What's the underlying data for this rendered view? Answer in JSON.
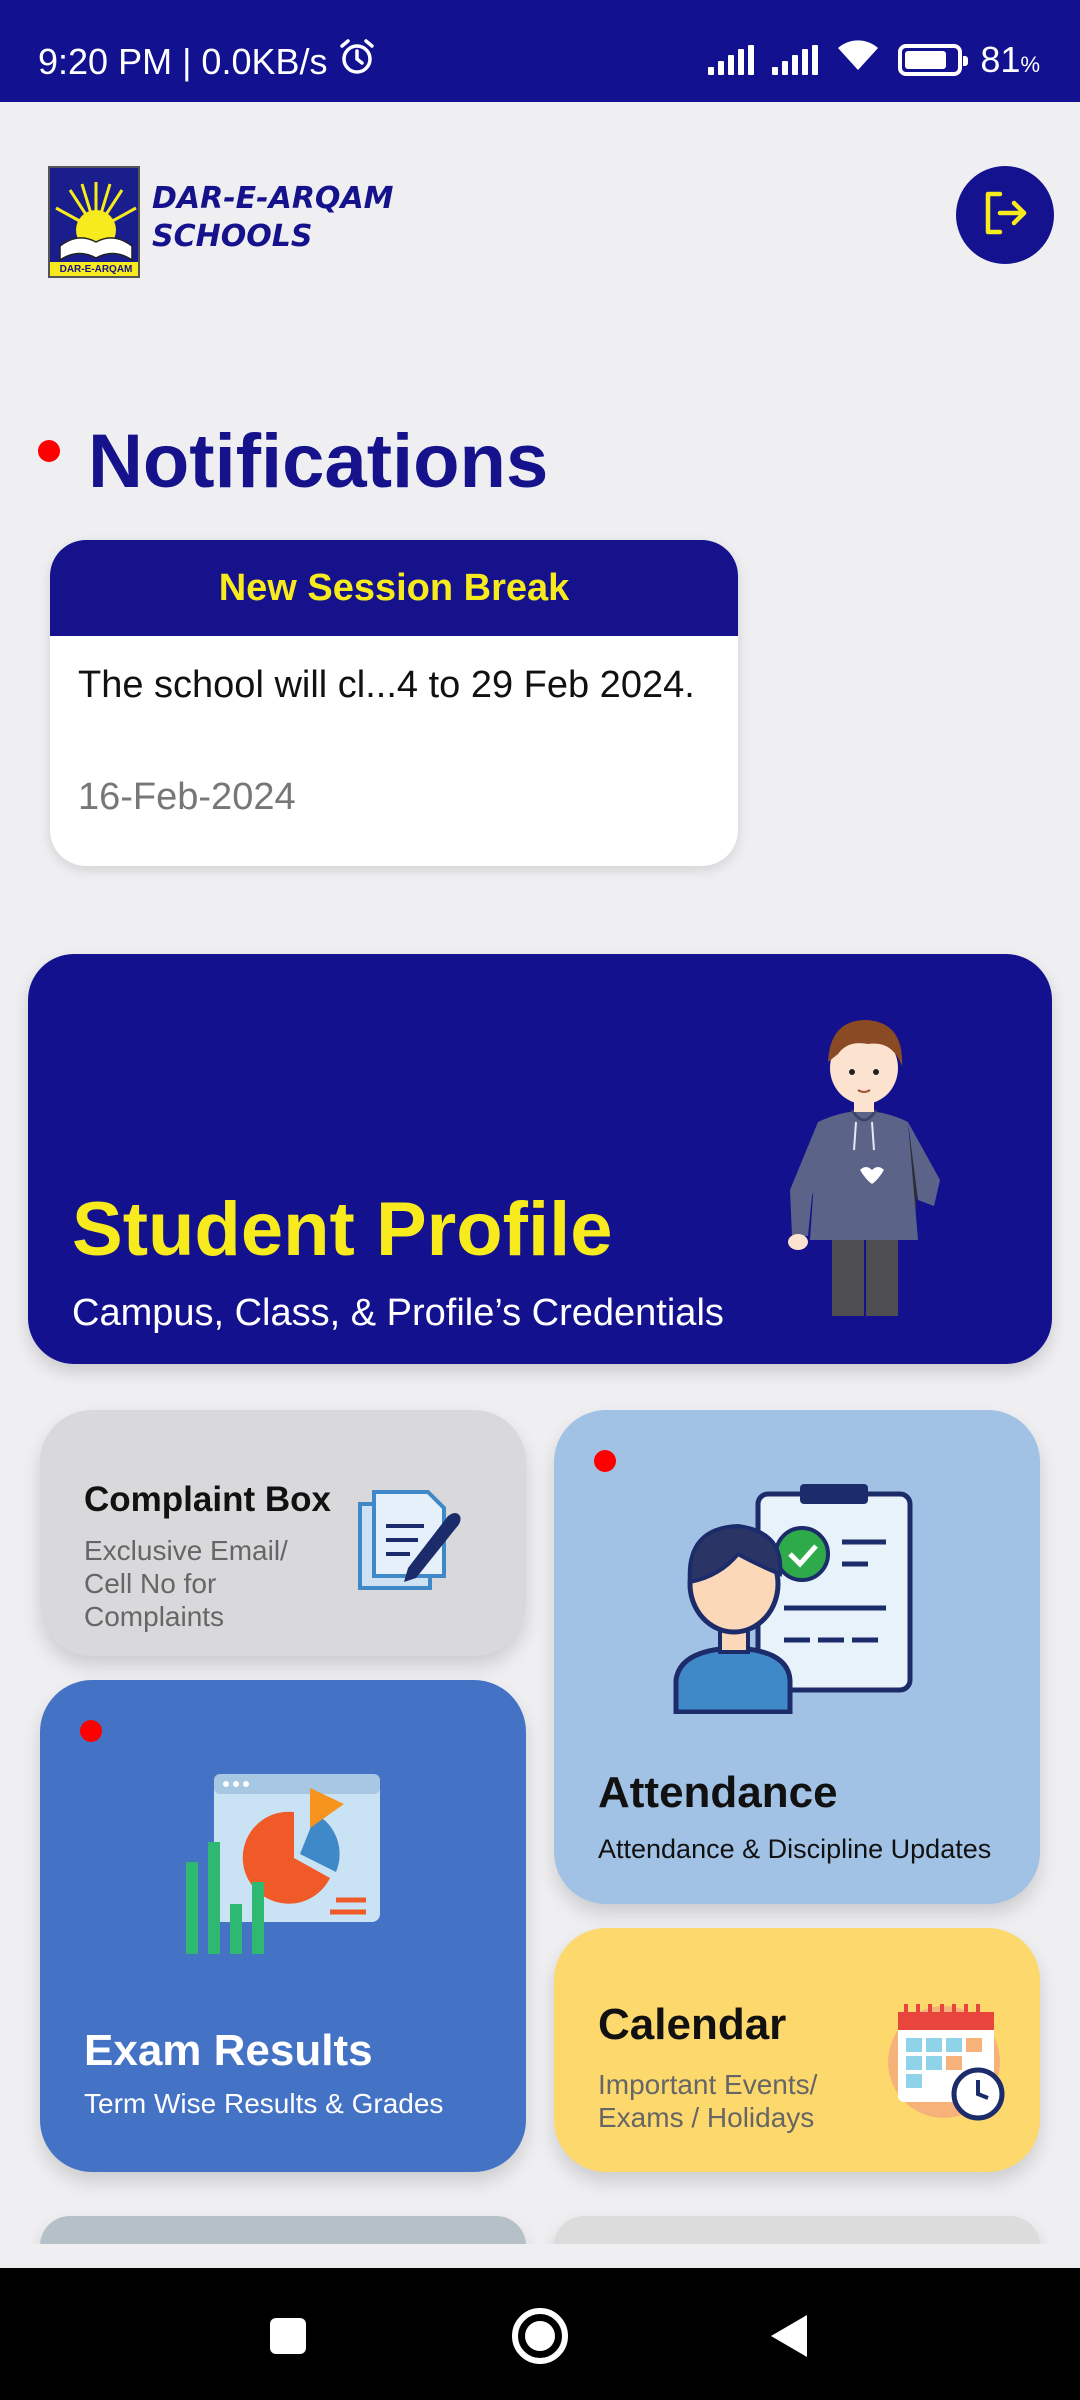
{
  "status_bar": {
    "time_speed": "9:20 PM | 0.0KB/s",
    "battery": "81",
    "battery_unit": "%",
    "battery_level": 0.81
  },
  "header": {
    "logo_line1": "DAR-E-ARQAM",
    "logo_line2": "SCHOOLS",
    "logo_badge_text": "DAR-E-ARQAM",
    "logout_icon": "logout-icon"
  },
  "notifications": {
    "title": "Notifications",
    "cards": [
      {
        "title": "New Session Break",
        "body": "The school will cl...4 to 29 Feb 2024.",
        "date": "16-Feb-2024"
      }
    ]
  },
  "profile": {
    "title": "Student Profile",
    "subtitle": "Campus, Class, & Profile’s Credentials"
  },
  "tiles": {
    "complaint": {
      "title": "Complaint Box",
      "subtitle": "Exclusive Email/ Cell No for Complaints"
    },
    "attendance": {
      "title": "Attendance",
      "subtitle": "Attendance & Discipline Updates"
    },
    "exam": {
      "title": "Exam Results",
      "subtitle": "Term Wise Results & Grades"
    },
    "calendar": {
      "title": "Calendar",
      "subtitle": "Important Events/ Exams / Holidays"
    }
  },
  "colors": {
    "brand_navy": "#14118f",
    "brand_yellow": "#f7ea1d",
    "attendance_bg": "#a1c2e5",
    "exam_bg": "#4472c4",
    "calendar_bg": "#fdd86d",
    "complaint_bg": "#d9d9dc",
    "alert_red": "#ff0000"
  }
}
